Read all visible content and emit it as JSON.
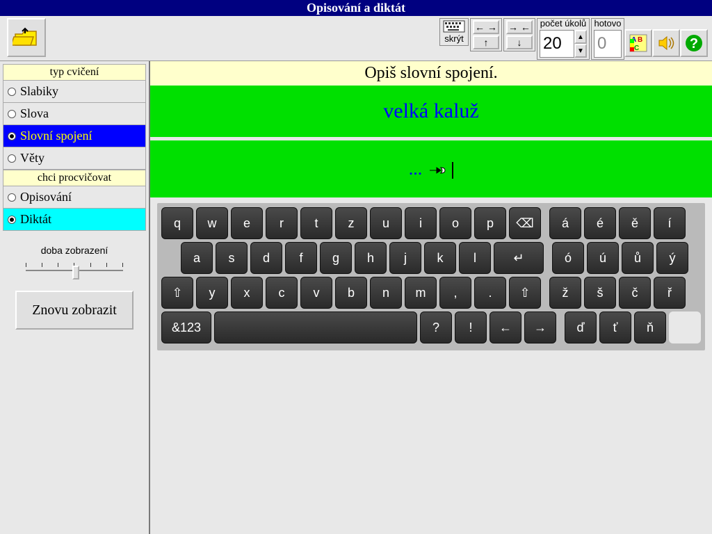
{
  "title": "Opisování a diktát",
  "toolbar": {
    "hide_label": "skrýt",
    "tasks_label": "počet úkolů",
    "tasks_value": "20",
    "done_label": "hotovo",
    "done_value": "0"
  },
  "sidebar": {
    "type_header": "typ cvičení",
    "type_options": [
      {
        "label": "Slabiky",
        "selected": false
      },
      {
        "label": "Slova",
        "selected": false
      },
      {
        "label": "Slovní spojení",
        "selected": true
      },
      {
        "label": "Věty",
        "selected": false
      }
    ],
    "practice_header": "chci procvičovat",
    "practice_options": [
      {
        "label": "Opisování",
        "selected": false
      },
      {
        "label": "Diktát",
        "selected": true
      }
    ],
    "slider_label": "doba zobrazení",
    "replay_button": "Znovu zobrazit"
  },
  "main": {
    "instruction": "Opiš slovní spojení.",
    "model_text": "velká kaluž",
    "input_placeholder": "..."
  },
  "keyboard": {
    "row1": [
      "q",
      "w",
      "e",
      "r",
      "t",
      "z",
      "u",
      "i",
      "o",
      "p"
    ],
    "row1_diacr": [
      "á",
      "é",
      "ě",
      "í"
    ],
    "row2": [
      "a",
      "s",
      "d",
      "f",
      "g",
      "h",
      "j",
      "k",
      "l"
    ],
    "row2_diacr": [
      "ó",
      "ú",
      "ů",
      "ý"
    ],
    "row3": [
      "y",
      "x",
      "c",
      "v",
      "b",
      "n",
      "m",
      ",",
      "."
    ],
    "row3_diacr": [
      "ž",
      "š",
      "č",
      "ř"
    ],
    "row4_num": "&123",
    "row4_punct": [
      "?",
      "!"
    ],
    "row4_diacr": [
      "ď",
      "ť",
      "ň"
    ]
  }
}
